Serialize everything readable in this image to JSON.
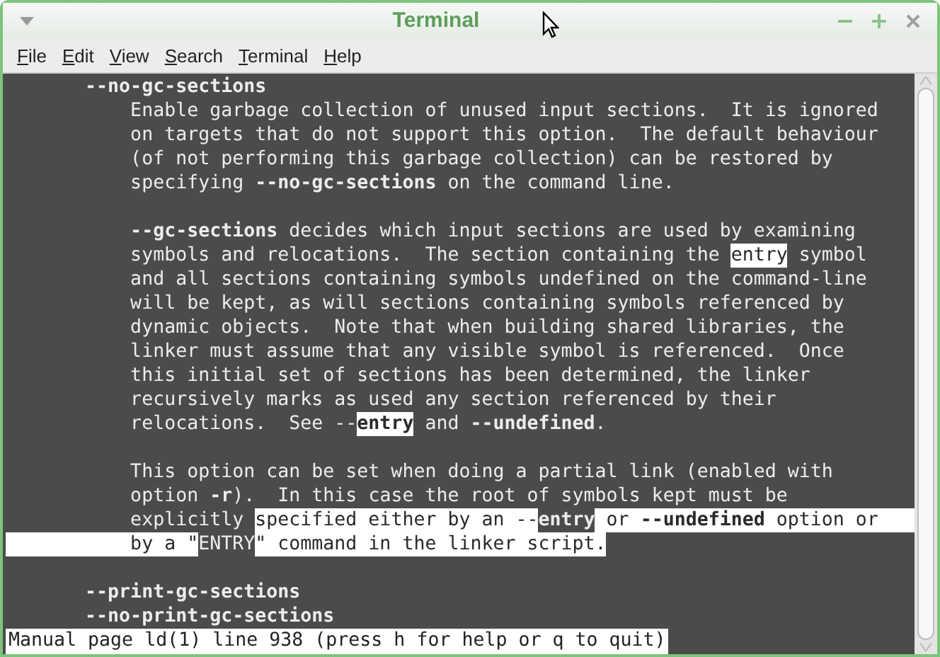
{
  "window": {
    "title": "Terminal"
  },
  "menu": [
    {
      "label": "File"
    },
    {
      "label": "Edit"
    },
    {
      "label": "View"
    },
    {
      "label": "Search"
    },
    {
      "label": "Terminal"
    },
    {
      "label": "Help"
    }
  ],
  "lines": [
    {
      "segments": [
        {
          "text": "       --no-gc-sections",
          "bold": true,
          "inverse": false
        }
      ]
    },
    {
      "segments": [
        {
          "text": "           Enable garbage collection of unused input sections.  It is ignored",
          "bold": false,
          "inverse": false
        }
      ]
    },
    {
      "segments": [
        {
          "text": "           on targets that do not support this option.  The default behaviour",
          "bold": false,
          "inverse": false
        }
      ]
    },
    {
      "segments": [
        {
          "text": "           (of not performing this garbage collection) can be restored by",
          "bold": false,
          "inverse": false
        }
      ]
    },
    {
      "segments": [
        {
          "text": "           specifying ",
          "bold": false,
          "inverse": false
        },
        {
          "text": "--no-gc-sections",
          "bold": true,
          "inverse": false
        },
        {
          "text": " on the command line.",
          "bold": false,
          "inverse": false
        }
      ]
    },
    {
      "gap_before": true,
      "segments": [
        {
          "text": "           --gc-sections",
          "bold": true,
          "inverse": false
        },
        {
          "text": " decides which input sections are used by examining",
          "bold": false,
          "inverse": false
        }
      ]
    },
    {
      "segments": [
        {
          "text": "           symbols and relocations.  The section containing the ",
          "bold": false,
          "inverse": false
        },
        {
          "text": "entry",
          "bold": false,
          "inverse": true
        },
        {
          "text": " symbol",
          "bold": false,
          "inverse": false
        }
      ]
    },
    {
      "segments": [
        {
          "text": "           and all sections containing symbols undefined on the command-line",
          "bold": false,
          "inverse": false
        }
      ]
    },
    {
      "segments": [
        {
          "text": "           will be kept, as will sections containing symbols referenced by",
          "bold": false,
          "inverse": false
        }
      ]
    },
    {
      "segments": [
        {
          "text": "           dynamic objects.  Note that when building shared libraries, the",
          "bold": false,
          "inverse": false
        }
      ]
    },
    {
      "segments": [
        {
          "text": "           linker must assume that any visible symbol is referenced.  Once",
          "bold": false,
          "inverse": false
        }
      ]
    },
    {
      "segments": [
        {
          "text": "           this initial set of sections has been determined, the linker",
          "bold": false,
          "inverse": false
        }
      ]
    },
    {
      "segments": [
        {
          "text": "           recursively marks as used any section referenced by their",
          "bold": false,
          "inverse": false
        }
      ]
    },
    {
      "segments": [
        {
          "text": "           relocations.  See --",
          "bold": false,
          "inverse": false
        },
        {
          "text": "entry",
          "bold": true,
          "inverse": true
        },
        {
          "text": " and ",
          "bold": false,
          "inverse": false
        },
        {
          "text": "--undefined",
          "bold": true,
          "inverse": false
        },
        {
          "text": ".",
          "bold": false,
          "inverse": false
        }
      ]
    },
    {
      "gap_before": true,
      "segments": [
        {
          "text": "           This option can be set when doing a partial link (enabled with",
          "bold": false,
          "inverse": false
        }
      ]
    },
    {
      "segments": [
        {
          "text": "           option ",
          "bold": false,
          "inverse": false
        },
        {
          "text": "-r",
          "bold": true,
          "inverse": false
        },
        {
          "text": ").  In this case the root of symbols kept must be",
          "bold": false,
          "inverse": false
        }
      ]
    },
    {
      "selected_to_end": true,
      "segments": [
        {
          "text": "           explicitly ",
          "bold": false,
          "inverse": false
        },
        {
          "text": "specified either by an --",
          "bold": false,
          "inverse": true
        },
        {
          "text": "entry",
          "bold": true,
          "inverse": false
        },
        {
          "text": " or ",
          "bold": false,
          "inverse": true
        },
        {
          "text": "--undefined",
          "bold": true,
          "inverse": true
        },
        {
          "text": " option or",
          "bold": false,
          "inverse": true
        }
      ]
    },
    {
      "segments": [
        {
          "text": "           by a \"",
          "bold": false,
          "inverse": true
        },
        {
          "text": "ENTRY",
          "bold": false,
          "inverse": false
        },
        {
          "text": "\" command in the linker script.",
          "bold": false,
          "inverse": true
        }
      ]
    },
    {
      "gap_before": true,
      "segments": [
        {
          "text": "       --print-gc-sections",
          "bold": true,
          "inverse": false
        }
      ]
    },
    {
      "segments": [
        {
          "text": "       --no-print-gc-sections",
          "bold": true,
          "inverse": false
        }
      ]
    }
  ],
  "status_bar": "Manual page ld(1) line 938 (press h for help or q to quit)"
}
